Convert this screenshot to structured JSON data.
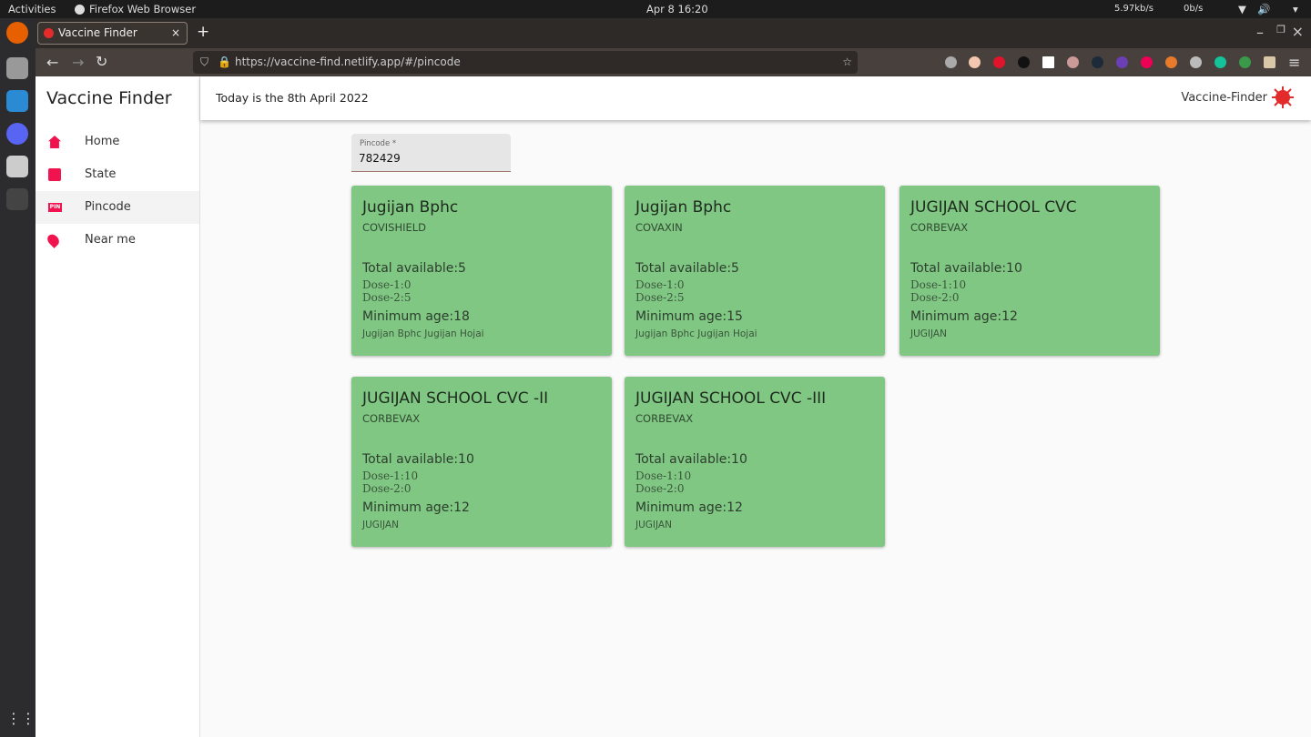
{
  "system": {
    "activities": "Activities",
    "app": "Firefox Web Browser",
    "clock": "Apr 8  16:20",
    "down": "5.97kb/s",
    "up": "0b/s"
  },
  "browser": {
    "tab_title": "Vaccine Finder",
    "url": "https://vaccine-find.netlify.app/#/pincode"
  },
  "sidebar": {
    "title": "Vaccine Finder",
    "items": [
      {
        "label": "Home",
        "icon": "home-icon"
      },
      {
        "label": "State",
        "icon": "state-search-icon"
      },
      {
        "label": "Pincode",
        "icon": "pin-icon"
      },
      {
        "label": "Near me",
        "icon": "location-pin-icon"
      }
    ],
    "active": "Pincode"
  },
  "header": {
    "today": "Today is the 8th April 2022",
    "logo": "Vaccine-Finder"
  },
  "pincode": {
    "label": "Pincode *",
    "value": "782429"
  },
  "colors": {
    "accent": "#f0134d",
    "card": "#81c784"
  },
  "cards": [
    {
      "name": "Jugijan Bphc",
      "vaccine": "COVISHIELD",
      "total": "Total available:5",
      "dose1": "Dose-1:0",
      "dose2": "Dose-2:5",
      "age": "Minimum age:18",
      "address": "Jugijan Bphc Jugijan Hojai"
    },
    {
      "name": "Jugijan Bphc",
      "vaccine": "COVAXIN",
      "total": "Total available:5",
      "dose1": "Dose-1:0",
      "dose2": "Dose-2:5",
      "age": "Minimum age:15",
      "address": "Jugijan Bphc Jugijan Hojai"
    },
    {
      "name": "JUGIJAN SCHOOL CVC",
      "vaccine": "CORBEVAX",
      "total": "Total available:10",
      "dose1": "Dose-1:10",
      "dose2": "Dose-2:0",
      "age": "Minimum age:12",
      "address": "JUGIJAN"
    },
    {
      "name": "JUGIJAN SCHOOL CVC -II",
      "vaccine": "CORBEVAX",
      "total": "Total available:10",
      "dose1": "Dose-1:10",
      "dose2": "Dose-2:0",
      "age": "Minimum age:12",
      "address": "JUGIJAN"
    },
    {
      "name": "JUGIJAN SCHOOL CVC -III",
      "vaccine": "CORBEVAX",
      "total": "Total available:10",
      "dose1": "Dose-1:10",
      "dose2": "Dose-2:0",
      "age": "Minimum age:12",
      "address": "JUGIJAN"
    }
  ]
}
